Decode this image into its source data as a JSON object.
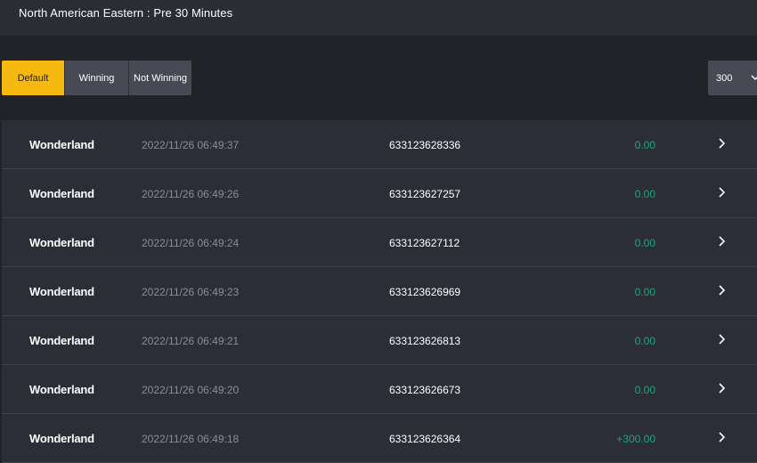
{
  "header": {
    "title": "North American Eastern : Pre 30 Minutes"
  },
  "filters": {
    "default_label": "Default",
    "winning_label": "Winning",
    "not_winning_label": "Not Winning",
    "active": "Default"
  },
  "page_size": {
    "value": "300"
  },
  "colors": {
    "accent": "#f5b90f",
    "positive": "#1fa57a",
    "background": "#212328",
    "row": "#2c2e37"
  },
  "rows": [
    {
      "game": "Wonderland",
      "time": "2022/11/26 06:49:37",
      "ticket": "633123628336",
      "amount": "0.00"
    },
    {
      "game": "Wonderland",
      "time": "2022/11/26 06:49:26",
      "ticket": "633123627257",
      "amount": "0.00"
    },
    {
      "game": "Wonderland",
      "time": "2022/11/26 06:49:24",
      "ticket": "633123627112",
      "amount": "0.00"
    },
    {
      "game": "Wonderland",
      "time": "2022/11/26 06:49:23",
      "ticket": "633123626969",
      "amount": "0.00"
    },
    {
      "game": "Wonderland",
      "time": "2022/11/26 06:49:21",
      "ticket": "633123626813",
      "amount": "0.00"
    },
    {
      "game": "Wonderland",
      "time": "2022/11/26 06:49:20",
      "ticket": "633123626673",
      "amount": "0.00"
    },
    {
      "game": "Wonderland",
      "time": "2022/11/26 06:49:18",
      "ticket": "633123626364",
      "amount": "+300.00"
    }
  ]
}
